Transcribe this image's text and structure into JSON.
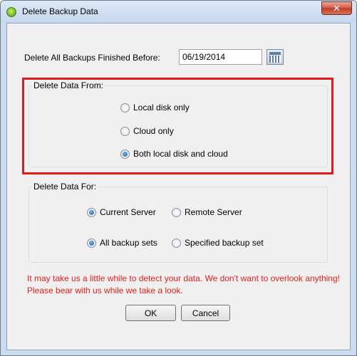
{
  "window": {
    "title": "Delete Backup Data",
    "close_glyph": "✕"
  },
  "date_filter": {
    "label": "Delete All Backups Finished Before:",
    "value": "06/19/2014"
  },
  "delete_from": {
    "title": "Delete Data From:",
    "options": [
      {
        "label": "Local disk only",
        "selected": false
      },
      {
        "label": "Cloud only",
        "selected": false
      },
      {
        "label": "Both local disk and cloud",
        "selected": true
      }
    ]
  },
  "delete_for": {
    "title": "Delete Data For:",
    "server_options": [
      {
        "label": "Current Server",
        "selected": true
      },
      {
        "label": "Remote Server",
        "selected": false
      }
    ],
    "set_options": [
      {
        "label": "All backup sets",
        "selected": true
      },
      {
        "label": "Specified backup set",
        "selected": false
      }
    ]
  },
  "warning": "It may take us a little while to detect your data. We don't want to overlook anything! Please bear with us while we take a look.",
  "buttons": {
    "ok": "OK",
    "cancel": "Cancel"
  },
  "colors": {
    "highlight": "#e01b1b",
    "warning_text": "#e0201b"
  }
}
